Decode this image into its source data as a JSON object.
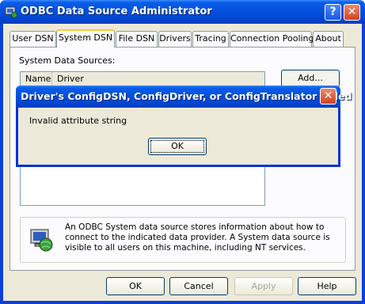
{
  "window": {
    "title": "ODBC Data Source Administrator",
    "help_glyph": "?",
    "close_glyph": "✕"
  },
  "tabs": [
    {
      "label": "User DSN",
      "active": false
    },
    {
      "label": "System DSN",
      "active": true
    },
    {
      "label": "File DSN",
      "active": false
    },
    {
      "label": "Drivers",
      "active": false
    },
    {
      "label": "Tracing",
      "active": false
    },
    {
      "label": "Connection Pooling",
      "active": false
    },
    {
      "label": "About",
      "active": false
    }
  ],
  "panel": {
    "sources_label": "System Data Sources:",
    "columns": [
      "Name",
      "Driver"
    ],
    "side_buttons": [
      "Add...",
      "",
      ""
    ],
    "info_text": "An ODBC System data source stores information about how to connect to the indicated data provider.  A System data source is visible to all users on this machine, including NT services."
  },
  "footer": {
    "ok": "OK",
    "cancel": "Cancel",
    "apply": "Apply",
    "help": "Help"
  },
  "error_dialog": {
    "title": "Driver's ConfigDSN, ConfigDriver, or ConfigTranslator failed",
    "message": "Invalid attribute string",
    "ok": "OK",
    "close_glyph": "✕"
  },
  "colors": {
    "titlebar": "#0552e0",
    "close_button": "#d04322",
    "dialog_face": "#ece9d8"
  }
}
